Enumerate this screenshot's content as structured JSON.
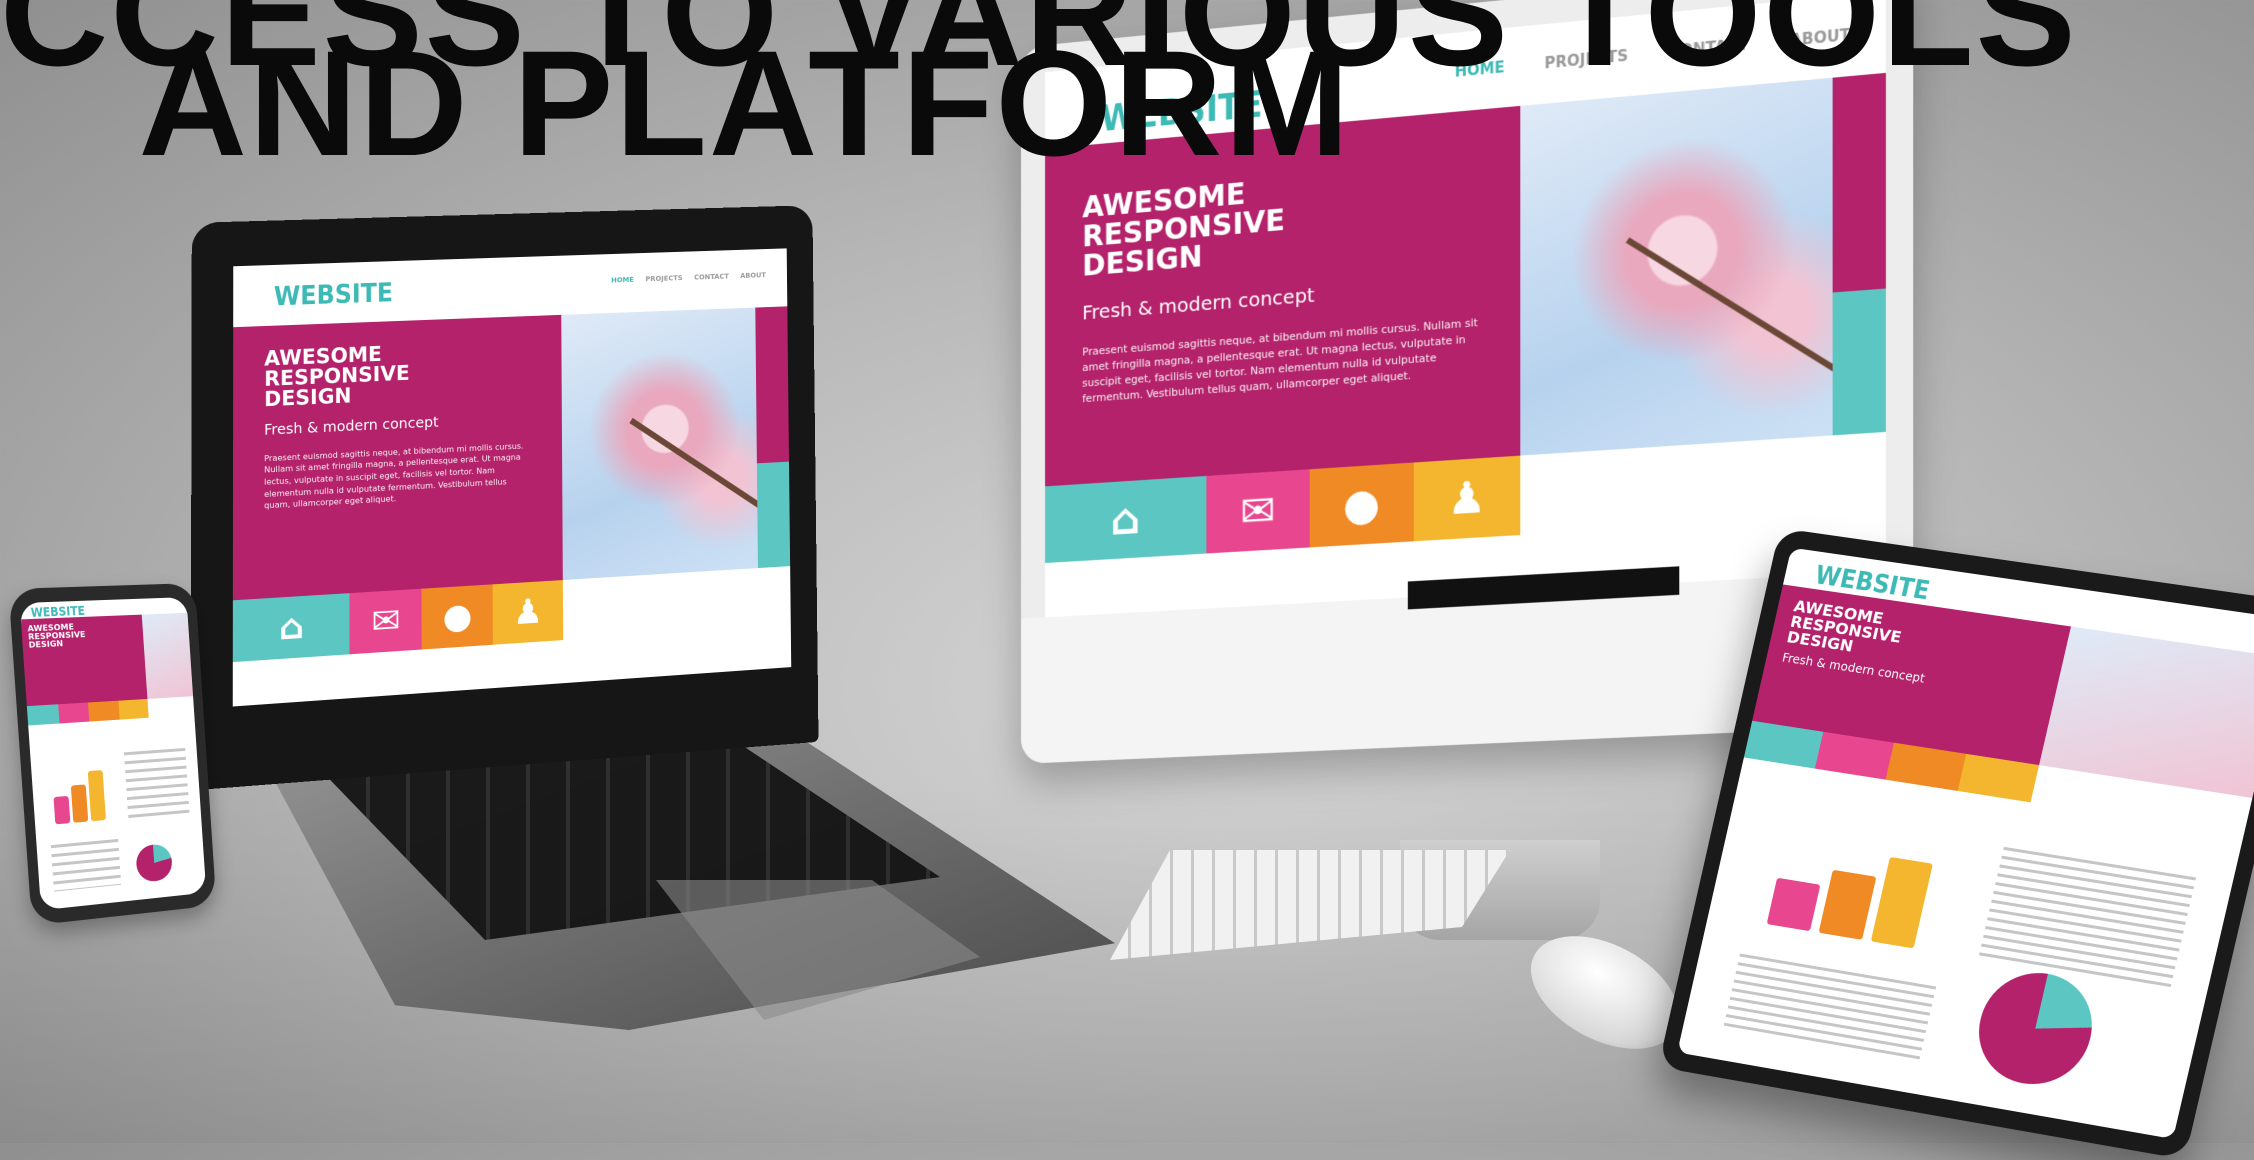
{
  "headline": {
    "line1": "CCESS TO VARIOUS TOOLS",
    "line2": "AND PLATFORM"
  },
  "website": {
    "logo": "WEBSITE",
    "nav": [
      "HOME",
      "PROJECTS",
      "CONTACT",
      "ABOUT"
    ],
    "hero_title": "AWESOME\nRESPONSIVE\nDESIGN",
    "hero_subtitle": "Fresh & modern concept",
    "hero_body": "Praesent euismod sagittis neque, at bibendum mi mollis cursus. Nullam sit amet fringilla magna, a pellentesque erat. Ut magna lectus, vulputate in suscipit eget, facilisis vel tortor. Nam elementum nulla id vulputate fermentum. Vestibulum tellus quam, ullamcorper eget aliquet.",
    "tiles": [
      {
        "icon": "home-icon",
        "glyph": "⌂"
      },
      {
        "icon": "mail-icon",
        "glyph": "✉"
      },
      {
        "icon": "globe-icon",
        "glyph": "●"
      },
      {
        "icon": "user-icon",
        "glyph": "♟"
      }
    ]
  },
  "colors": {
    "magenta": "#b3226a",
    "teal": "#5cc6c3",
    "pink": "#e8478f",
    "orange": "#f08a24",
    "yellow": "#f3b62e"
  }
}
